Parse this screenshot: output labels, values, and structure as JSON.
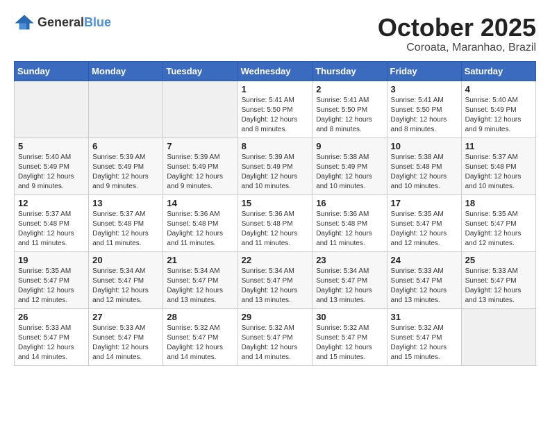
{
  "header": {
    "logo": {
      "general": "General",
      "blue": "Blue"
    },
    "title": "October 2025",
    "location": "Coroata, Maranhao, Brazil"
  },
  "calendar": {
    "days_of_week": [
      "Sunday",
      "Monday",
      "Tuesday",
      "Wednesday",
      "Thursday",
      "Friday",
      "Saturday"
    ],
    "weeks": [
      [
        {
          "day": "",
          "info": ""
        },
        {
          "day": "",
          "info": ""
        },
        {
          "day": "",
          "info": ""
        },
        {
          "day": "1",
          "info": "Sunrise: 5:41 AM\nSunset: 5:50 PM\nDaylight: 12 hours\nand 8 minutes."
        },
        {
          "day": "2",
          "info": "Sunrise: 5:41 AM\nSunset: 5:50 PM\nDaylight: 12 hours\nand 8 minutes."
        },
        {
          "day": "3",
          "info": "Sunrise: 5:41 AM\nSunset: 5:50 PM\nDaylight: 12 hours\nand 8 minutes."
        },
        {
          "day": "4",
          "info": "Sunrise: 5:40 AM\nSunset: 5:49 PM\nDaylight: 12 hours\nand 9 minutes."
        }
      ],
      [
        {
          "day": "5",
          "info": "Sunrise: 5:40 AM\nSunset: 5:49 PM\nDaylight: 12 hours\nand 9 minutes."
        },
        {
          "day": "6",
          "info": "Sunrise: 5:39 AM\nSunset: 5:49 PM\nDaylight: 12 hours\nand 9 minutes."
        },
        {
          "day": "7",
          "info": "Sunrise: 5:39 AM\nSunset: 5:49 PM\nDaylight: 12 hours\nand 9 minutes."
        },
        {
          "day": "8",
          "info": "Sunrise: 5:39 AM\nSunset: 5:49 PM\nDaylight: 12 hours\nand 10 minutes."
        },
        {
          "day": "9",
          "info": "Sunrise: 5:38 AM\nSunset: 5:49 PM\nDaylight: 12 hours\nand 10 minutes."
        },
        {
          "day": "10",
          "info": "Sunrise: 5:38 AM\nSunset: 5:48 PM\nDaylight: 12 hours\nand 10 minutes."
        },
        {
          "day": "11",
          "info": "Sunrise: 5:37 AM\nSunset: 5:48 PM\nDaylight: 12 hours\nand 10 minutes."
        }
      ],
      [
        {
          "day": "12",
          "info": "Sunrise: 5:37 AM\nSunset: 5:48 PM\nDaylight: 12 hours\nand 11 minutes."
        },
        {
          "day": "13",
          "info": "Sunrise: 5:37 AM\nSunset: 5:48 PM\nDaylight: 12 hours\nand 11 minutes."
        },
        {
          "day": "14",
          "info": "Sunrise: 5:36 AM\nSunset: 5:48 PM\nDaylight: 12 hours\nand 11 minutes."
        },
        {
          "day": "15",
          "info": "Sunrise: 5:36 AM\nSunset: 5:48 PM\nDaylight: 12 hours\nand 11 minutes."
        },
        {
          "day": "16",
          "info": "Sunrise: 5:36 AM\nSunset: 5:48 PM\nDaylight: 12 hours\nand 11 minutes."
        },
        {
          "day": "17",
          "info": "Sunrise: 5:35 AM\nSunset: 5:47 PM\nDaylight: 12 hours\nand 12 minutes."
        },
        {
          "day": "18",
          "info": "Sunrise: 5:35 AM\nSunset: 5:47 PM\nDaylight: 12 hours\nand 12 minutes."
        }
      ],
      [
        {
          "day": "19",
          "info": "Sunrise: 5:35 AM\nSunset: 5:47 PM\nDaylight: 12 hours\nand 12 minutes."
        },
        {
          "day": "20",
          "info": "Sunrise: 5:34 AM\nSunset: 5:47 PM\nDaylight: 12 hours\nand 12 minutes."
        },
        {
          "day": "21",
          "info": "Sunrise: 5:34 AM\nSunset: 5:47 PM\nDaylight: 12 hours\nand 13 minutes."
        },
        {
          "day": "22",
          "info": "Sunrise: 5:34 AM\nSunset: 5:47 PM\nDaylight: 12 hours\nand 13 minutes."
        },
        {
          "day": "23",
          "info": "Sunrise: 5:34 AM\nSunset: 5:47 PM\nDaylight: 12 hours\nand 13 minutes."
        },
        {
          "day": "24",
          "info": "Sunrise: 5:33 AM\nSunset: 5:47 PM\nDaylight: 12 hours\nand 13 minutes."
        },
        {
          "day": "25",
          "info": "Sunrise: 5:33 AM\nSunset: 5:47 PM\nDaylight: 12 hours\nand 13 minutes."
        }
      ],
      [
        {
          "day": "26",
          "info": "Sunrise: 5:33 AM\nSunset: 5:47 PM\nDaylight: 12 hours\nand 14 minutes."
        },
        {
          "day": "27",
          "info": "Sunrise: 5:33 AM\nSunset: 5:47 PM\nDaylight: 12 hours\nand 14 minutes."
        },
        {
          "day": "28",
          "info": "Sunrise: 5:32 AM\nSunset: 5:47 PM\nDaylight: 12 hours\nand 14 minutes."
        },
        {
          "day": "29",
          "info": "Sunrise: 5:32 AM\nSunset: 5:47 PM\nDaylight: 12 hours\nand 14 minutes."
        },
        {
          "day": "30",
          "info": "Sunrise: 5:32 AM\nSunset: 5:47 PM\nDaylight: 12 hours\nand 15 minutes."
        },
        {
          "day": "31",
          "info": "Sunrise: 5:32 AM\nSunset: 5:47 PM\nDaylight: 12 hours\nand 15 minutes."
        },
        {
          "day": "",
          "info": ""
        }
      ]
    ]
  }
}
